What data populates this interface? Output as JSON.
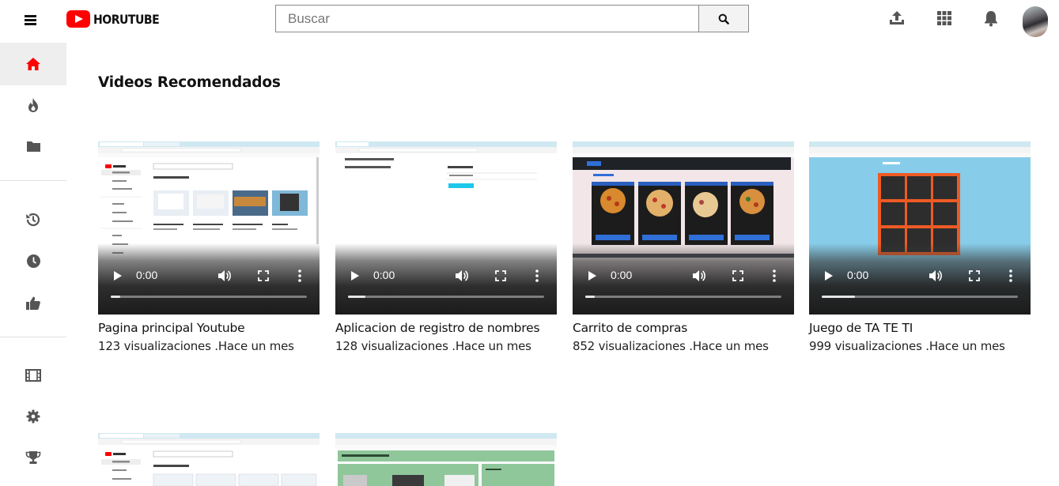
{
  "header": {
    "logo_text": "HORUTUBE",
    "search_placeholder": "Buscar",
    "brand_color": "#ff0000"
  },
  "sidebar": {
    "items": [
      {
        "icon": "home-icon",
        "active": true
      },
      {
        "icon": "fire-icon"
      },
      {
        "icon": "folder-icon"
      },
      {
        "icon": "history-icon"
      },
      {
        "icon": "clock-icon"
      },
      {
        "icon": "thumbs-up-icon"
      },
      {
        "icon": "film-icon"
      },
      {
        "icon": "gear-icon"
      },
      {
        "icon": "trophy-icon"
      }
    ]
  },
  "main": {
    "section_title": "Videos Recomendados",
    "videos": [
      {
        "title": "Pagina principal Youtube",
        "meta": "123 visualizaciones .Hace un mes",
        "time": "0:00",
        "progress": 0.05
      },
      {
        "title": "Aplicacion de registro de nombres",
        "meta": "128 visualizaciones .Hace un mes",
        "time": "0:00",
        "progress": 0.09
      },
      {
        "title": "Carrito de compras",
        "meta": "852 visualizaciones .Hace un mes",
        "time": "0:00",
        "progress": 0.05
      },
      {
        "title": "Juego de TA TE TI",
        "meta": "999 visualizaciones .Hace un mes",
        "time": "0:00",
        "progress": 0.17
      },
      {
        "title": "",
        "meta": "",
        "time": "",
        "progress": 0
      },
      {
        "title": "",
        "meta": "",
        "time": "",
        "progress": 0
      }
    ]
  }
}
